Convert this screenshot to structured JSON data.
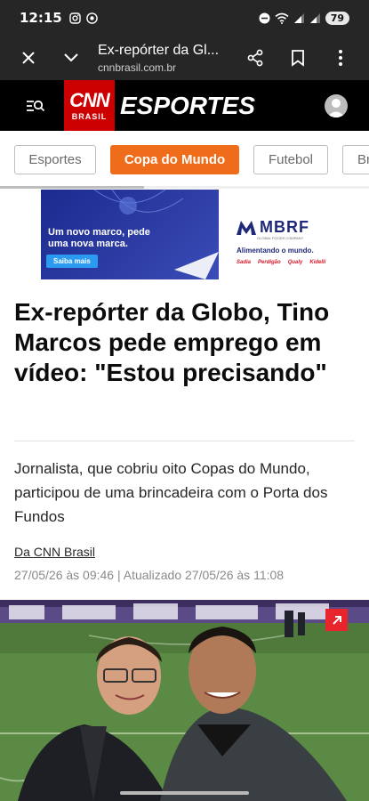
{
  "status_bar": {
    "time": "12:15",
    "battery": "79"
  },
  "browser": {
    "title": "Ex-repórter da Globo",
    "title_display": "Ex-repórter da Gl...",
    "domain": "cnnbrasil.com.br"
  },
  "header": {
    "logo_text": "CNN",
    "logo_sub": "BRASIL",
    "section": "ESPORTES"
  },
  "tabs": [
    {
      "label": "Esportes",
      "active": false
    },
    {
      "label": "Copa do Mundo",
      "active": true
    },
    {
      "label": "Futebol",
      "active": false
    },
    {
      "label": "Br",
      "active": false
    }
  ],
  "ad": {
    "headline": "Um novo marco, pede uma nova marca.",
    "button": "Saiba mais",
    "brand": "MBRF",
    "brand_sub": "GLOBAL FOODS COMPANY",
    "slogan": "Alimentando o mundo.",
    "brands": [
      "Sadia",
      "Perdigão",
      "Qualy",
      "Kidelli"
    ]
  },
  "article": {
    "headline": "Ex-repórter da Globo, Tino Marcos pede emprego em vídeo: \"Estou precisando\"",
    "subhead": "Jornalista, que cobriu oito Copas do Mundo, participou de uma brincadeira com o Porta dos Fundos",
    "author": "Da CNN Brasil",
    "dates": "27/05/26 às 09:46 | Atualizado 27/05/26 às 11:08"
  },
  "colors": {
    "accent": "#ef6c1a",
    "cnn_red": "#cc0000",
    "header_bg": "#000000",
    "browser_bg": "#262626"
  }
}
